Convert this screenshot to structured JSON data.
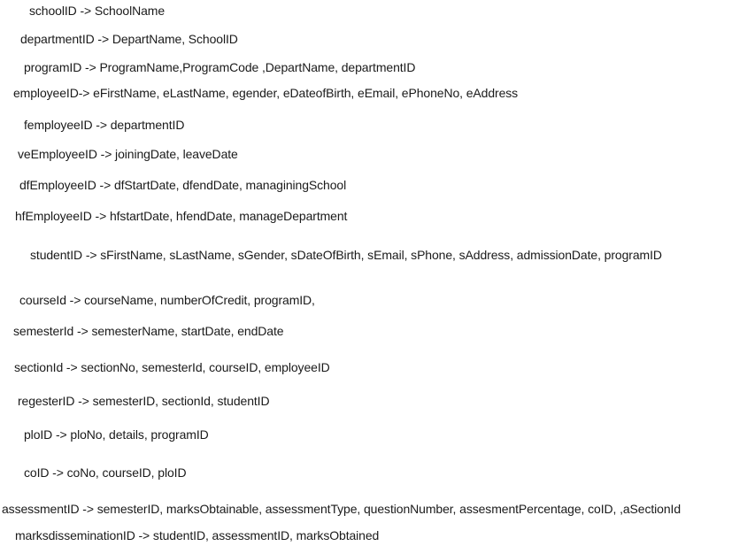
{
  "dependencies": [
    "schoolID -> SchoolName",
    "departmentID -> DepartName, SchoolID",
    "programID -> ProgramName,ProgramCode ,DepartName, departmentID",
    "employeeID-> eFirstName, eLastName, egender, eDateofBirth, eEmail, ePhoneNo, eAddress",
    "femployeeID ->  departmentID",
    "veEmployeeID -> joiningDate, leaveDate",
    "dfEmployeeID -> dfStartDate, dfendDate, managiningSchool",
    "hfEmployeeID -> hfstartDate, hfendDate, manageDepartment",
    "studentID -> sFirstName, sLastName, sGender, sDateOfBirth, sEmail, sPhone, sAddress, admissionDate, programID",
    "courseId -> courseName, numberOfCredit, programID,",
    "semesterId -> semesterName, startDate, endDate",
    "sectionId -> sectionNo, semesterId, courseID, employeeID",
    "regesterID -> semesterID, sectionId, studentID",
    "ploID -> ploNo, details, programID",
    "coID -> coNo, courseID, ploID",
    "assessmentID -> semesterID, marksObtainable, assessmentType, questionNumber, assesmentPercentage, coID, ,aSectionId",
    "marksdisseminationID -> studentID, assessmentID, marksObtained"
  ]
}
